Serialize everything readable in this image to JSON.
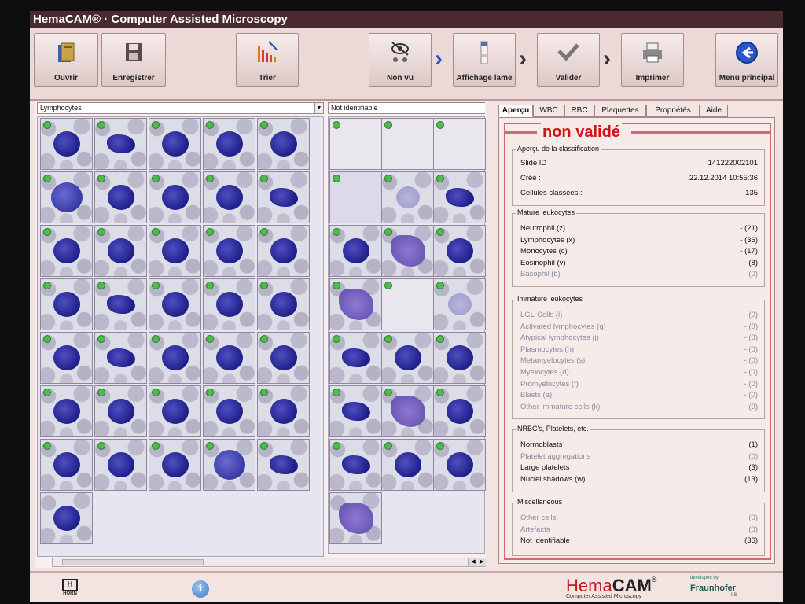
{
  "window": {
    "title": "HemaCAM® · Computer Assisted Microscopy"
  },
  "toolbar": {
    "open": "Ouvrir",
    "save": "Enregistrer",
    "sort": "Trier",
    "not_seen": "Non vu",
    "slide_view": "Affichage lame",
    "validate": "Valider",
    "print": "Imprimer",
    "main_menu": "Menu principal"
  },
  "left_panel": {
    "lymphocytes_dropdown": "Lymphocytes",
    "not_identifiable_dropdown": "Not identifiable"
  },
  "tabs": [
    "Aperçu",
    "WBC",
    "RBC",
    "Plaquettes",
    "Propriétés",
    "Aide"
  ],
  "status": "non validé",
  "overview": {
    "title": "Aperçu de la classification",
    "slide_id_label": "Slide ID",
    "slide_id": "141222002101",
    "created_label": "Créé :",
    "created": "22.12.2014 10:55:36",
    "classified_label": "Cellules classées :",
    "classified": "135"
  },
  "groups": {
    "mature": {
      "title": "Mature leukocytes",
      "rows": [
        {
          "label": "Neutrophil (z)",
          "value": "- (21)",
          "dim": false
        },
        {
          "label": "Lymphocytes (x)",
          "value": "- (36)",
          "dim": false
        },
        {
          "label": "Monocytes (c)",
          "value": "- (17)",
          "dim": false
        },
        {
          "label": "Eosinophil (v)",
          "value": "- (8)",
          "dim": false
        },
        {
          "label": "Basophil (b)",
          "value": "- (0)",
          "dim": true
        }
      ]
    },
    "immature": {
      "title": "Immature leukocytes",
      "rows": [
        {
          "label": "LGL-Cells (l)",
          "value": "- (0)",
          "dim": true
        },
        {
          "label": "Activated lymphocytes (g)",
          "value": "- (0)",
          "dim": true
        },
        {
          "label": "Atypical lymphocytes (j)",
          "value": "- (0)",
          "dim": true
        },
        {
          "label": "Plasmocytes (h)",
          "value": "- (0)",
          "dim": true
        },
        {
          "label": "Metamyelocytes (s)",
          "value": "- (0)",
          "dim": true
        },
        {
          "label": "Myelocytes (d)",
          "value": "- (0)",
          "dim": true
        },
        {
          "label": "Promyelocytes (f)",
          "value": "- (0)",
          "dim": true
        },
        {
          "label": "Blasts (a)",
          "value": "- (0)",
          "dim": true
        },
        {
          "label": "Other immature cells (k)",
          "value": "- (0)",
          "dim": true
        }
      ]
    },
    "nrbc": {
      "title": "NRBC's, Platelets, etc.",
      "rows": [
        {
          "label": "Normoblasts",
          "value": "(1)",
          "dim": false
        },
        {
          "label": "Platelet aggregations",
          "value": "(0)",
          "dim": true
        },
        {
          "label": "Large platelets",
          "value": "(3)",
          "dim": false
        },
        {
          "label": "Nuclei shadows (w)",
          "value": "(13)",
          "dim": false
        }
      ]
    },
    "misc": {
      "title": "Miscellaneous",
      "rows": [
        {
          "label": "Other cells",
          "value": "(0)",
          "dim": true
        },
        {
          "label": "Artefacts",
          "value": "(0)",
          "dim": true
        },
        {
          "label": "Not identifiable",
          "value": "(36)",
          "dim": false
        }
      ]
    }
  },
  "footer": {
    "brand_hema": "Hema",
    "brand_cam": "CAM",
    "brand_reg": "®",
    "brand_tagline": "Computer Assisted Microscopy",
    "horn_logo": "HORN",
    "developed_by": "developed by",
    "fraunhofer": "Fraunhofer",
    "iis": "IIS"
  },
  "colors": {
    "accent_red": "#d11414",
    "chevron_blue": "#1f4fd0",
    "selection_green": "#4dbb4d",
    "nucleus_blue": "#1e1f8a"
  }
}
